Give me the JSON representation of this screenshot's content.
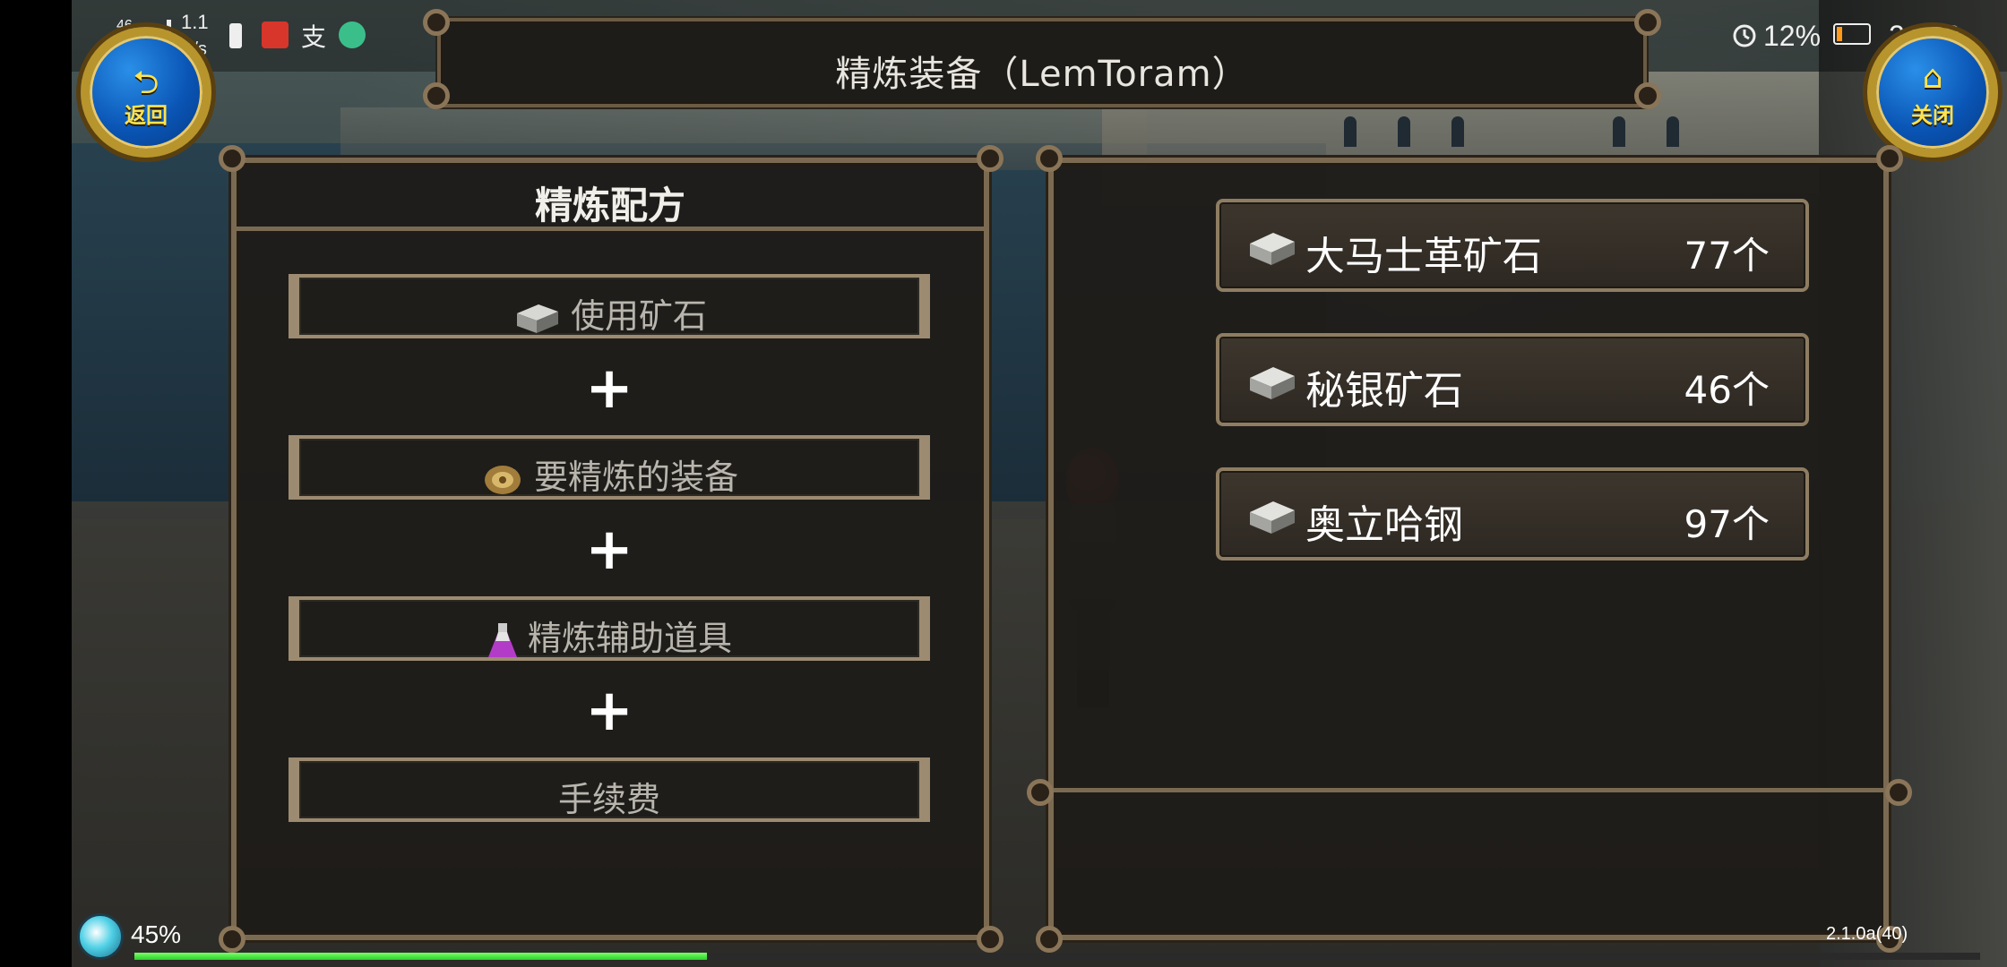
{
  "status_bar": {
    "network_type": "46",
    "net_speed_value": "1.1",
    "net_speed_unit": "K/s",
    "alarm_icon": "alarm-icon",
    "battery_percent": "12%",
    "time": "21:28"
  },
  "header": {
    "title": "精炼装备（LemToram）",
    "back_label": "返回",
    "close_label": "关闭"
  },
  "recipe_panel": {
    "title": "精炼配方",
    "slots": [
      {
        "label": "使用矿石",
        "icon": "ore-icon"
      },
      {
        "label": "要精炼的装备",
        "icon": "equipment-icon"
      },
      {
        "label": "精炼辅助道具",
        "icon": "potion-icon"
      },
      {
        "label": "手续费",
        "icon": ""
      }
    ],
    "plus_sign": "+"
  },
  "materials_panel": {
    "items": [
      {
        "name": "大马士革矿石",
        "count": "77个",
        "icon": "ore-icon"
      },
      {
        "name": "秘银矿石",
        "count": "46个",
        "icon": "ore-icon"
      },
      {
        "name": "奥立哈钢",
        "count": "97个",
        "icon": "ore-icon"
      }
    ]
  },
  "footer": {
    "load_percent": "45%",
    "version": "2.1.0a(40)",
    "progress_fraction": 0.31
  },
  "colors": {
    "panel_border": "#7b6a52",
    "button_gold": "#ffe34d",
    "button_blue": "#0a55b5",
    "progress_green": "#2bd02a"
  }
}
